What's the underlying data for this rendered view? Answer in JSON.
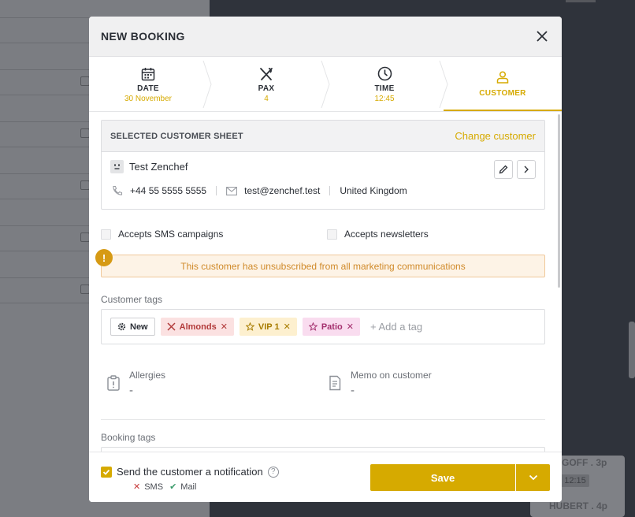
{
  "background": {
    "card_text_1": "GOFF . 3p",
    "card_time": "12:15",
    "card_text_2": "HUBERT . 4p"
  },
  "modal": {
    "title": "NEW BOOKING"
  },
  "steps": [
    {
      "label": "DATE",
      "value": "30 November",
      "icon": "calendar-icon"
    },
    {
      "label": "PAX",
      "value": "4",
      "icon": "fork-knife-icon"
    },
    {
      "label": "TIME",
      "value": "12:45",
      "icon": "clock-icon"
    },
    {
      "label": "CUSTOMER",
      "value": "",
      "icon": "user-icon"
    }
  ],
  "customer_sheet": {
    "title": "SELECTED CUSTOMER SHEET",
    "change_label": "Change customer",
    "name": "Test Zenchef",
    "phone": "+44 55 5555 5555",
    "email": "test@zenchef.test",
    "country": "United Kingdom"
  },
  "consents": {
    "sms_label": "Accepts SMS campaigns",
    "newsletter_label": "Accepts newsletters"
  },
  "alert": {
    "badge": "!",
    "text": "This customer has unsubscribed from all marketing communications"
  },
  "customer_tags": {
    "label": "Customer tags",
    "tags": [
      {
        "label": "New",
        "style": "new"
      },
      {
        "label": "Almonds",
        "style": "almonds"
      },
      {
        "label": "VIP 1",
        "style": "vip"
      },
      {
        "label": "Patio",
        "style": "patio"
      }
    ],
    "add_placeholder": "+ Add a tag"
  },
  "allergies": {
    "title": "Allergies",
    "value": "-"
  },
  "memo": {
    "title": "Memo on customer",
    "value": "-"
  },
  "booking_tags": {
    "label": "Booking tags"
  },
  "footer": {
    "notify_label": "Send the customer a notification",
    "sms_label": "SMS",
    "mail_label": "Mail",
    "save_label": "Save"
  },
  "colors": {
    "accent": "#d6aa00",
    "alert": "#d08a2a"
  }
}
